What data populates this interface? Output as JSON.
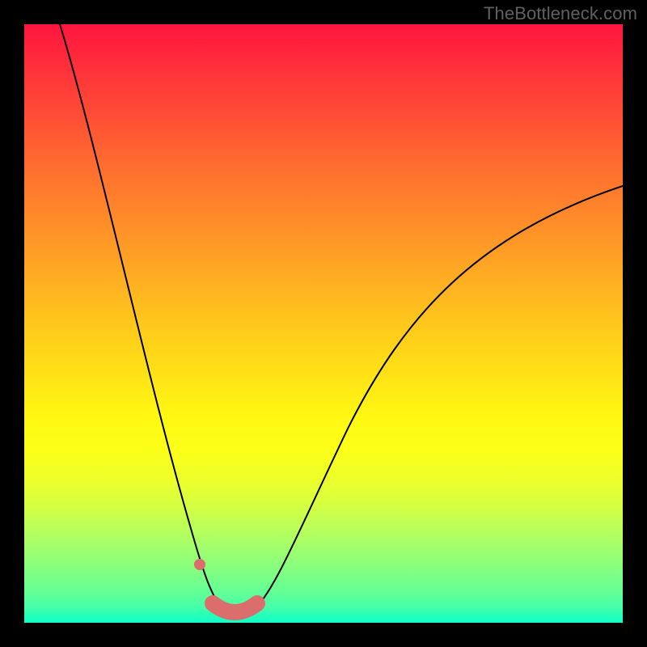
{
  "watermark": "TheBottleneck.com",
  "colors": {
    "accent_stroke": "#db6d6d",
    "curve_stroke": "#000000",
    "frame_bg": "#000000",
    "gradient_top": "#ff153e",
    "gradient_bottom": "#11ffc7"
  },
  "chart_data": {
    "type": "line",
    "title": "",
    "xlabel": "",
    "ylabel": "",
    "xlim": [
      0,
      100
    ],
    "ylim": [
      0,
      100
    ],
    "series": [
      {
        "name": "bottleneck-curve",
        "x": [
          6,
          8,
          10,
          12,
          14,
          16,
          18,
          20,
          22,
          24,
          26,
          28,
          29.5,
          31,
          32.5,
          34,
          35.5,
          37,
          40,
          43,
          46,
          50,
          55,
          60,
          65,
          70,
          75,
          80,
          85,
          90,
          95,
          100
        ],
        "y": [
          100,
          92,
          84,
          76,
          68,
          60,
          52,
          44,
          36,
          29,
          22,
          15,
          10,
          6,
          3,
          1.5,
          1.5,
          3,
          7,
          12,
          18,
          25,
          33,
          40,
          46,
          51,
          56,
          60,
          64,
          67.5,
          70.5,
          73
        ]
      }
    ],
    "highlight": {
      "name": "optimal-range",
      "x_start": 31,
      "x_end": 38,
      "y": 1.5
    },
    "marker": {
      "name": "point-before-optimal",
      "x": 29,
      "y": 9
    }
  }
}
